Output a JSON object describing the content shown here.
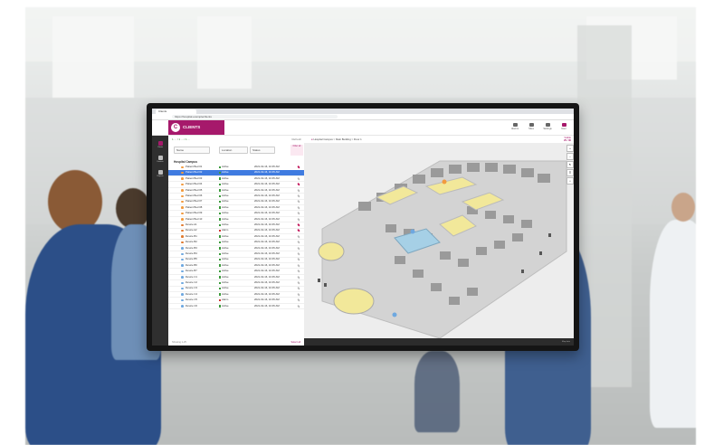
{
  "browser": {
    "tab_title": "Clients",
    "url": "https://hospital.example/clients"
  },
  "app": {
    "logo_letter": "C",
    "title": "CLIENTS",
    "header_icons": [
      "Alarms",
      "Sites",
      "Settings",
      "User"
    ]
  },
  "nav": {
    "items": [
      "Clients",
      "Devices",
      "Reports"
    ]
  },
  "list": {
    "summary": "1 ... / 1 ... / 1 ...",
    "summary_right": "Refresh",
    "columns": [
      "Name",
      "Location",
      "Status"
    ],
    "side_filter": "Filter all",
    "group": "Hospital Campus",
    "rows": [
      {
        "name": "Patient Bed 01",
        "status": "Active",
        "time": "2021-02-16, 10:45 AM",
        "color": "#f29a3d",
        "pin": "#c2185b"
      },
      {
        "name": "Patient Bed 02",
        "status": "Active",
        "time": "2021-02-16, 10:45 AM",
        "color": "#f29a3d",
        "pin": "#3f7be0"
      },
      {
        "name": "Patient Bed 03",
        "status": "Active",
        "time": "2021-02-16, 10:45 AM",
        "color": "#f29a3d",
        "pin": "#bbbbbb"
      },
      {
        "name": "Patient Bed 04",
        "status": "Active",
        "time": "2021-02-16, 10:45 AM",
        "color": "#f29a3d",
        "pin": "#c2185b"
      },
      {
        "name": "Patient Bed 05",
        "status": "Active",
        "time": "2021-02-16, 10:45 AM",
        "color": "#f29a3d",
        "pin": "#bbbbbb"
      },
      {
        "name": "Patient Bed 06",
        "status": "Active",
        "time": "2021-02-16, 10:45 AM",
        "color": "#f29a3d",
        "pin": "#bbbbbb"
      },
      {
        "name": "Patient Bed 07",
        "status": "Active",
        "time": "2021-02-16, 10:45 AM",
        "color": "#f29a3d",
        "pin": "#bbbbbb"
      },
      {
        "name": "Patient Bed 08",
        "status": "Active",
        "time": "2021-02-16, 10:45 AM",
        "color": "#f29a3d",
        "pin": "#bbbbbb"
      },
      {
        "name": "Patient Bed 09",
        "status": "Active",
        "time": "2021-02-16, 10:45 AM",
        "color": "#f29a3d",
        "pin": "#bbbbbb"
      },
      {
        "name": "Patient Bed 10",
        "status": "Active",
        "time": "2021-02-16, 10:45 AM",
        "color": "#f29a3d",
        "pin": "#bbbbbb"
      },
      {
        "name": "Device A1",
        "status": "Active",
        "time": "2021-02-16, 10:45 AM",
        "color": "#e07a2f",
        "pin": "#c2185b"
      },
      {
        "name": "Device A2",
        "status": "Alarm",
        "time": "2021-02-16, 10:45 AM",
        "color": "#e07a2f",
        "pin": "#c2185b"
      },
      {
        "name": "Device B1",
        "status": "Active",
        "time": "2021-02-16, 10:45 AM",
        "color": "#e07a2f",
        "pin": "#bbbbbb"
      },
      {
        "name": "Device B2",
        "status": "Active",
        "time": "2021-02-16, 10:45 AM",
        "color": "#e07a2f",
        "pin": "#bbbbbb"
      },
      {
        "name": "Device B3",
        "status": "Active",
        "time": "2021-02-16, 10:45 AM",
        "color": "#6ea8e0",
        "pin": "#bbbbbb"
      },
      {
        "name": "Device B4",
        "status": "Active",
        "time": "2021-02-16, 10:45 AM",
        "color": "#6ea8e0",
        "pin": "#bbbbbb"
      },
      {
        "name": "Device B5",
        "status": "Active",
        "time": "2021-02-16, 10:45 AM",
        "color": "#6ea8e0",
        "pin": "#bbbbbb"
      },
      {
        "name": "Device B6",
        "status": "Active",
        "time": "2021-02-16, 10:45 AM",
        "color": "#6ea8e0",
        "pin": "#bbbbbb"
      },
      {
        "name": "Device B7",
        "status": "Active",
        "time": "2021-02-16, 10:45 AM",
        "color": "#6ea8e0",
        "pin": "#bbbbbb"
      },
      {
        "name": "Device C1",
        "status": "Active",
        "time": "2021-02-16, 10:45 AM",
        "color": "#6ea8e0",
        "pin": "#bbbbbb"
      },
      {
        "name": "Device C2",
        "status": "Active",
        "time": "2021-02-16, 10:45 AM",
        "color": "#6ea8e0",
        "pin": "#bbbbbb"
      },
      {
        "name": "Device C3",
        "status": "Active",
        "time": "2021-02-16, 10:45 AM",
        "color": "#6ea8e0",
        "pin": "#bbbbbb"
      },
      {
        "name": "Device C4",
        "status": "Active",
        "time": "2021-02-16, 10:45 AM",
        "color": "#6ea8e0",
        "pin": "#bbbbbb"
      },
      {
        "name": "Device C5",
        "status": "Alarm",
        "time": "2021-02-16, 10:45 AM",
        "color": "#6ea8e0",
        "pin": "#bbbbbb"
      },
      {
        "name": "Device C6",
        "status": "Active",
        "time": "2021-02-16, 10:45 AM",
        "color": "#6ea8e0",
        "pin": "#bbbbbb"
      }
    ],
    "footer_left": "Showing 1-25",
    "footer_right": "Select all"
  },
  "map": {
    "breadcrumb": "Hospital Campus > Main Building > Floor 1",
    "kpi_label": "Visible",
    "kpi_value": "25 / 30",
    "footer": "Map data"
  }
}
